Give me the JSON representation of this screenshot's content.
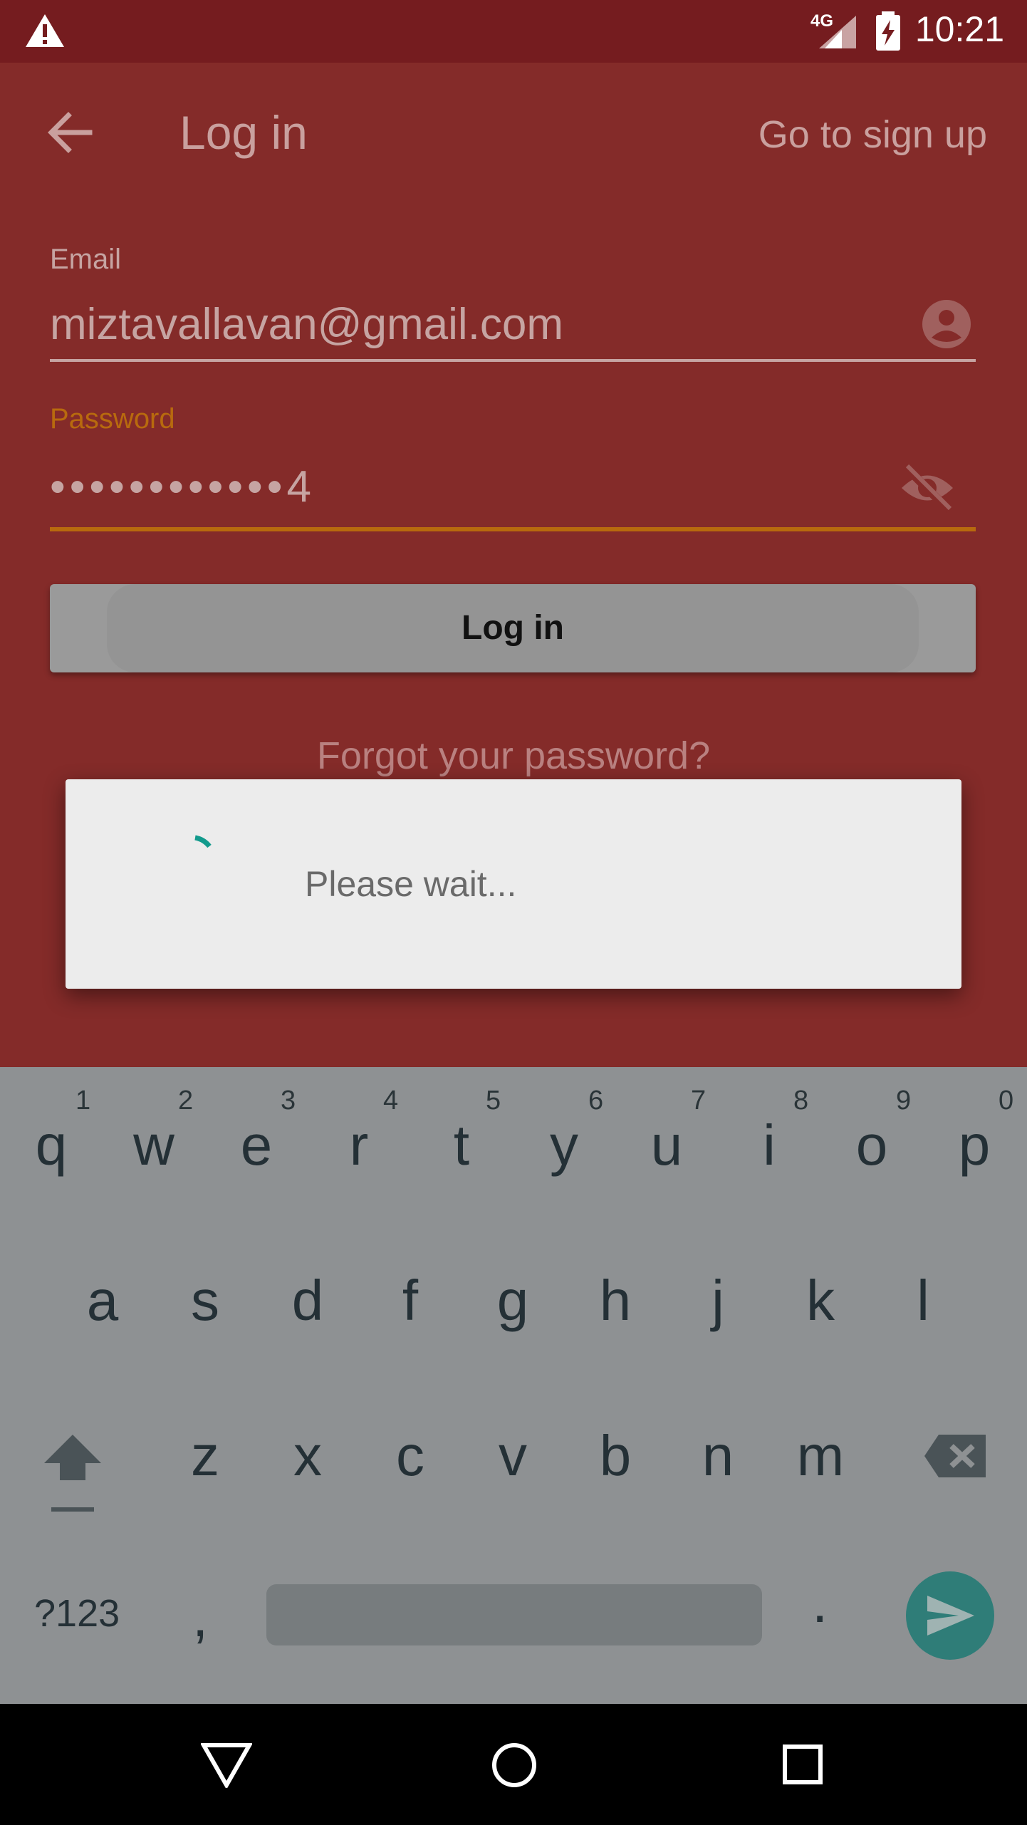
{
  "status_bar": {
    "time": "10:21",
    "network": "4G"
  },
  "app_bar": {
    "title": "Log in",
    "signup_link": "Go to sign up"
  },
  "email": {
    "label": "Email",
    "value": "miztavallavan@gmail.com"
  },
  "password": {
    "label": "Password",
    "value": "••••••••••••4"
  },
  "login_button": "Log in",
  "forgot_link": "Forgot your password?",
  "dialog": {
    "message": "Please wait..."
  },
  "keyboard": {
    "row1": [
      "q",
      "w",
      "e",
      "r",
      "t",
      "y",
      "u",
      "i",
      "o",
      "p"
    ],
    "row1_hints": [
      "1",
      "2",
      "3",
      "4",
      "5",
      "6",
      "7",
      "8",
      "9",
      "0"
    ],
    "row2": [
      "a",
      "s",
      "d",
      "f",
      "g",
      "h",
      "j",
      "k",
      "l"
    ],
    "row3": [
      "z",
      "x",
      "c",
      "v",
      "b",
      "n",
      "m"
    ],
    "symbols_key": "?123",
    "comma": ",",
    "period": "."
  },
  "colors": {
    "primary_dark": "#751c1f",
    "primary": "#842b29",
    "accent": "#b86a0e",
    "dialog_bg": "#ececec",
    "keyboard_bg": "#8e9193",
    "enter_key": "#2f7d78"
  }
}
